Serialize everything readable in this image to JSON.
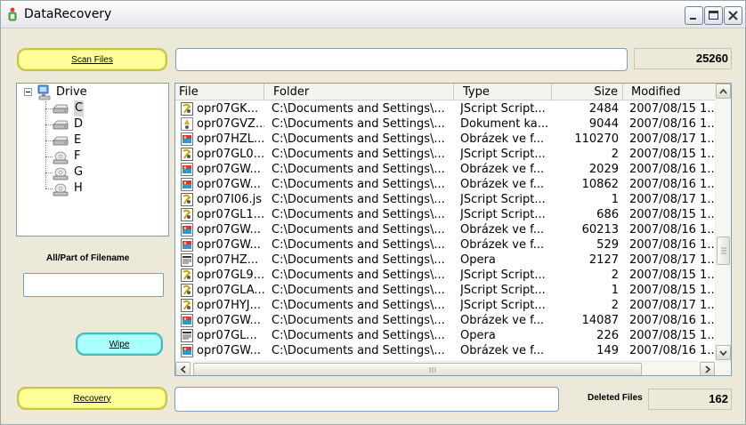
{
  "window": {
    "title": "DataRecovery"
  },
  "buttons": {
    "scan": "Scan Files",
    "wipe": "Wipe",
    "recovery": "Recovery"
  },
  "scan": {
    "path_value": "",
    "file_count": "25260"
  },
  "tree": {
    "root": "Drive",
    "drives": [
      {
        "letter": "C",
        "icon": "hard-drive-icon",
        "selected": true
      },
      {
        "letter": "D",
        "icon": "hard-drive-icon"
      },
      {
        "letter": "E",
        "icon": "hard-drive-icon"
      },
      {
        "letter": "F",
        "icon": "cd-drive-icon"
      },
      {
        "letter": "G",
        "icon": "cd-drive-icon"
      },
      {
        "letter": "H",
        "icon": "cd-drive-icon"
      }
    ]
  },
  "filter": {
    "label": "All/Part of Filename",
    "value": ""
  },
  "list": {
    "columns": [
      "File",
      "Folder",
      "Type",
      "Size",
      "Modified"
    ],
    "rows": [
      {
        "file": "opr07GK...",
        "folder": "C:\\Documents and Settings\\...",
        "type": "JScript Script...",
        "size": "2484",
        "modified": "2007/08/15 1...",
        "icon": "script-file-icon"
      },
      {
        "file": "opr07GVZ...",
        "folder": "C:\\Documents and Settings\\...",
        "type": "Dokument ka...",
        "size": "9044",
        "modified": "2007/08/16 1...",
        "icon": "stylesheet-file-icon"
      },
      {
        "file": "opr07HZL...",
        "folder": "C:\\Documents and Settings\\...",
        "type": "Obrázek ve f...",
        "size": "110270",
        "modified": "2007/08/17 1...",
        "icon": "image-file-icon"
      },
      {
        "file": "opr07GL0...",
        "folder": "C:\\Documents and Settings\\...",
        "type": "JScript Script...",
        "size": "2",
        "modified": "2007/08/15 1...",
        "icon": "script-file-icon"
      },
      {
        "file": "opr07GW...",
        "folder": "C:\\Documents and Settings\\...",
        "type": "Obrázek ve f...",
        "size": "2029",
        "modified": "2007/08/16 1...",
        "icon": "image-file-icon"
      },
      {
        "file": "opr07GW...",
        "folder": "C:\\Documents and Settings\\...",
        "type": "Obrázek ve f...",
        "size": "10862",
        "modified": "2007/08/16 1...",
        "icon": "image-file-icon"
      },
      {
        "file": "opr07I06.js",
        "folder": "C:\\Documents and Settings\\...",
        "type": "JScript Script...",
        "size": "1",
        "modified": "2007/08/17 1...",
        "icon": "script-file-icon"
      },
      {
        "file": "opr07GL1...",
        "folder": "C:\\Documents and Settings\\...",
        "type": "JScript Script...",
        "size": "686",
        "modified": "2007/08/15 1...",
        "icon": "script-file-icon"
      },
      {
        "file": "opr07GW...",
        "folder": "C:\\Documents and Settings\\...",
        "type": "Obrázek ve f...",
        "size": "60213",
        "modified": "2007/08/16 1...",
        "icon": "image-file-icon"
      },
      {
        "file": "opr07GW...",
        "folder": "C:\\Documents and Settings\\...",
        "type": "Obrázek ve f...",
        "size": "529",
        "modified": "2007/08/16 1...",
        "icon": "image-file-icon"
      },
      {
        "file": "opr07HZ...",
        "folder": "C:\\Documents and Settings\\...",
        "type": "Opera",
        "size": "2127",
        "modified": "2007/08/17 1...",
        "icon": "opera-file-icon"
      },
      {
        "file": "opr07GL9...",
        "folder": "C:\\Documents and Settings\\...",
        "type": "JScript Script...",
        "size": "2",
        "modified": "2007/08/15 1...",
        "icon": "script-file-icon"
      },
      {
        "file": "opr07GLA...",
        "folder": "C:\\Documents and Settings\\...",
        "type": "JScript Script...",
        "size": "1",
        "modified": "2007/08/15 1...",
        "icon": "script-file-icon"
      },
      {
        "file": "opr07HYJ...",
        "folder": "C:\\Documents and Settings\\...",
        "type": "JScript Script...",
        "size": "2",
        "modified": "2007/08/17 1...",
        "icon": "script-file-icon"
      },
      {
        "file": "opr07GW...",
        "folder": "C:\\Documents and Settings\\...",
        "type": "Obrázek ve f...",
        "size": "14087",
        "modified": "2007/08/16 1...",
        "icon": "image-file-icon"
      },
      {
        "file": "opr07GL...",
        "folder": "C:\\Documents and Settings\\...",
        "type": "Opera",
        "size": "226",
        "modified": "2007/08/15 1...",
        "icon": "opera-file-icon"
      },
      {
        "file": "opr07GW...",
        "folder": "C:\\Documents and Settings\\...",
        "type": "Obrázek ve f...",
        "size": "149",
        "modified": "2007/08/16 1...",
        "icon": "image-file-icon"
      }
    ]
  },
  "recovery": {
    "path_value": "",
    "deleted_label": "Deleted Files",
    "deleted_count": "162"
  },
  "colors": {
    "button_yellow": "#ffff99",
    "button_cyan": "#aaffff",
    "window_bg": "#ece9d8"
  }
}
